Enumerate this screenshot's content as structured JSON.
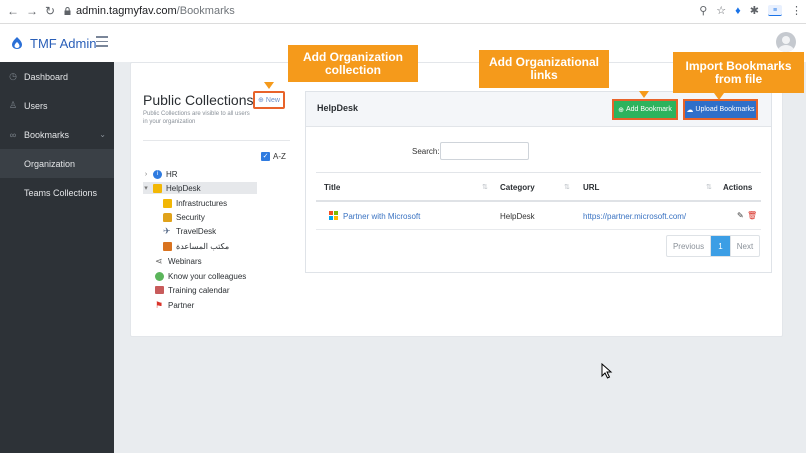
{
  "browser": {
    "url_host": "admin.tagmyfav.com",
    "url_path": "/Bookmarks"
  },
  "brand": {
    "title": "TMF Admin"
  },
  "sidebar": {
    "items": [
      {
        "label": "Dashboard",
        "icon": "clock-icon"
      },
      {
        "label": "Users",
        "icon": "user-icon"
      },
      {
        "label": "Bookmarks",
        "icon": "link-icon"
      },
      {
        "label": "Organization",
        "active": true
      },
      {
        "label": "Teams Collections"
      }
    ]
  },
  "public_collections": {
    "title": "Public Collections",
    "subtitle": "Public Collections are visible to all users in your organization",
    "new_label": "New",
    "sort_label": "A-Z"
  },
  "tree": [
    {
      "label": "HR",
      "icon": "info-icon",
      "color": "#2f7be0"
    },
    {
      "label": "HelpDesk",
      "icon": "folder-icon",
      "color": "#f2b705"
    },
    {
      "label": "Infrastructures",
      "icon": "folder-icon",
      "color": "#f2b705"
    },
    {
      "label": "Security",
      "icon": "lock-icon",
      "color": "#e0a21a"
    },
    {
      "label": "TravelDesk",
      "icon": "plane-icon",
      "color": "#5a6d8a"
    },
    {
      "label": "مكتب المساعدة",
      "icon": "briefcase-icon",
      "color": "#d9731f"
    },
    {
      "label": "Webinars",
      "icon": "share-icon",
      "color": "#666666"
    },
    {
      "label": "Know your colleagues",
      "icon": "chat-icon",
      "color": "#5bb55b"
    },
    {
      "label": "Training calendar",
      "icon": "calendar-icon",
      "color": "#c85b5b"
    },
    {
      "label": "Partner",
      "icon": "flag-icon",
      "color": "#d9342b"
    }
  ],
  "helpdesk": {
    "title": "HelpDesk",
    "add_bookmark": "Add Bookmark",
    "upload_bookmarks": "Upload Bookmarks",
    "search_label": "Search:",
    "columns": [
      "Title",
      "Category",
      "URL",
      "Actions"
    ],
    "rows": [
      {
        "title": "Partner with Microsoft",
        "category": "HelpDesk",
        "url": "https://partner.microsoft.com/"
      }
    ],
    "pager": {
      "previous": "Previous",
      "current": "1",
      "next": "Next"
    }
  },
  "callouts": {
    "org_collection": "Add Organization collection",
    "org_links": "Add Organizational links",
    "import": "Import Bookmarks from file"
  },
  "colors": {
    "callout": "#f59a1b",
    "callout_border": "#e8632a",
    "sidebar_bg": "#2d3237",
    "add_green": "#2db35d",
    "upload_blue": "#2f6fc9"
  }
}
